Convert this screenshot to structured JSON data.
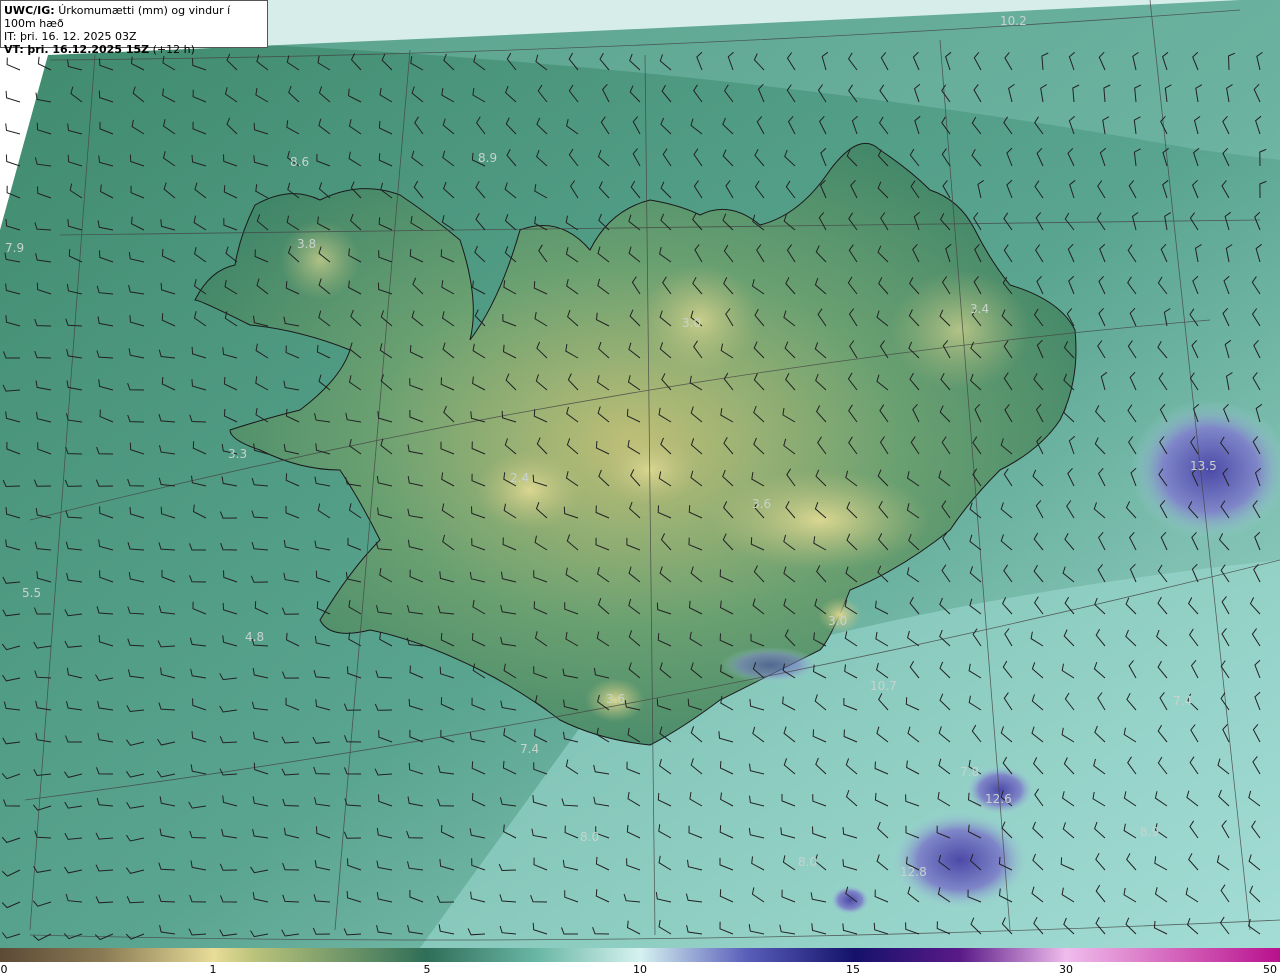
{
  "header": {
    "model": "UWC/IG:",
    "title": "Úrkomumætti (mm) og vindur í 100m hæð",
    "it_label": "IT: þri. 16. 12. 2025 03Z",
    "vt_prefix": "VT:",
    "vt_value": "þri. 16.12.2025 15Z",
    "vt_lead": "(+12 h)"
  },
  "map_labels": [
    {
      "text": "10.2"
    },
    {
      "text": "8.6"
    },
    {
      "text": "8.9"
    },
    {
      "text": "7.9"
    },
    {
      "text": "3.8"
    },
    {
      "text": "3.0"
    },
    {
      "text": "3.4"
    },
    {
      "text": "3.3"
    },
    {
      "text": "2.4"
    },
    {
      "text": "3.6"
    },
    {
      "text": "13.5"
    },
    {
      "text": "5.5"
    },
    {
      "text": "4.8"
    },
    {
      "text": "3.0"
    },
    {
      "text": "3.6"
    },
    {
      "text": "10.7"
    },
    {
      "text": "7.4"
    },
    {
      "text": "7.4"
    },
    {
      "text": "7.8"
    },
    {
      "text": "12.6"
    },
    {
      "text": "8.0"
    },
    {
      "text": "8.0"
    },
    {
      "text": "8.9"
    },
    {
      "text": "12.8"
    }
  ],
  "colorbar": {
    "ticks": [
      "0",
      "1",
      "5",
      "10",
      "15",
      "30",
      "50"
    ],
    "colors": [
      "#5c4a36",
      "#b8a86a",
      "#e8e49a",
      "#2f7a5e",
      "#6fc6b4",
      "#d8f4f2",
      "#4a4fb0",
      "#16146e",
      "#6a1a8a",
      "#f0b8ea",
      "#c0108f"
    ]
  }
}
